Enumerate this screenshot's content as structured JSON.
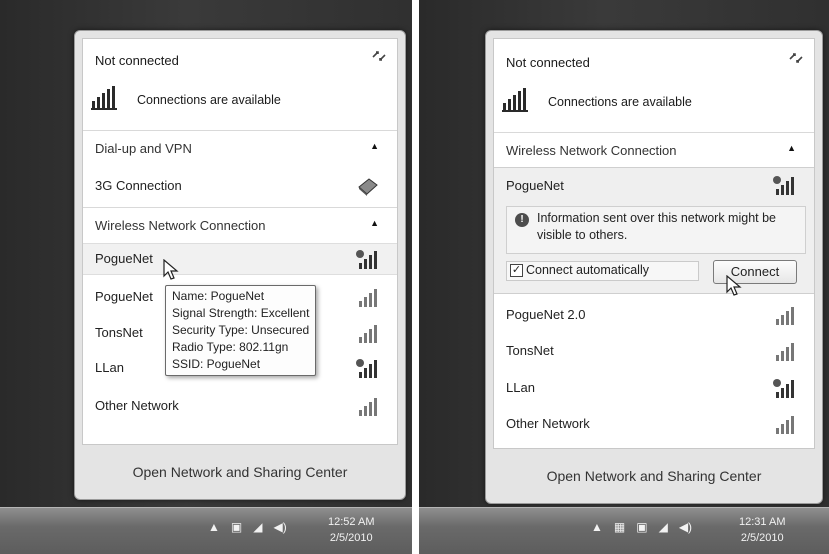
{
  "left": {
    "status_title": "Not connected",
    "status_sub": "Connections are available",
    "section_dialup": "Dial-up and VPN",
    "connection_3g": "3G Connection",
    "section_wireless": "Wireless Network Connection",
    "networks": [
      "PogueNet",
      "PogueNet",
      "TonsNet",
      "LLan",
      "Other Network"
    ],
    "tooltip": [
      "Name: PogueNet",
      "Signal Strength: Excellent",
      "Security Type: Unsecured",
      "Radio Type: 802.11gn",
      "SSID: PogueNet"
    ],
    "footer_link": "Open Network and Sharing Center",
    "clock_time": "12:52 AM",
    "clock_date": "2/5/2010"
  },
  "right": {
    "status_title": "Not connected",
    "status_sub": "Connections are available",
    "section_wireless": "Wireless Network Connection",
    "selected_network": "PogueNet",
    "info_text": "Information sent over this network might be visible to others.",
    "connect_auto_label": "Connect automatically",
    "connect_auto_checked": true,
    "connect_button": "Connect",
    "networks": [
      "PogueNet 2.0",
      "TonsNet",
      "LLan",
      "Other Network"
    ],
    "footer_link": "Open Network and Sharing Center",
    "clock_time": "12:31 AM",
    "clock_date": "2/5/2010"
  },
  "icons": {
    "refresh": "refresh-icon",
    "network_status": "network-bars-icon",
    "signal": "signal-strength-icon",
    "secured_signal": "secured-signal-icon",
    "modem": "modem-icon",
    "shield": "shield-icon",
    "pointer": "mouse-pointer-icon",
    "caret_up": "chevron-up-icon"
  },
  "colors": {
    "panel_bg": "#ffffff",
    "chrome": "#e4e4e4",
    "taskbar": "#6a6a6a",
    "desktop": "#2f2f2f"
  }
}
